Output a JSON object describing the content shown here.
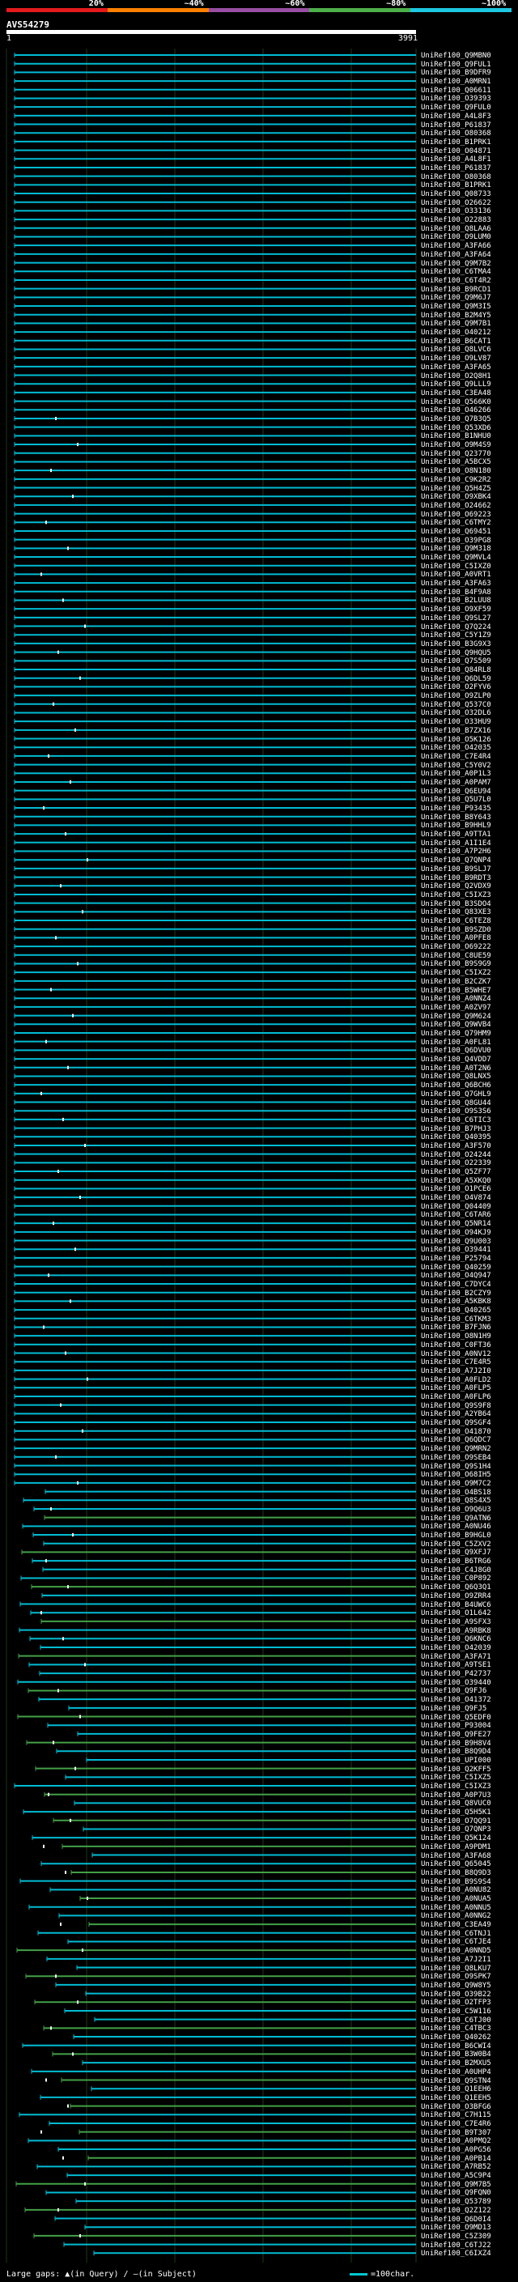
{
  "legend": {
    "percent_labels": [
      "20%",
      "~40%",
      "~60%",
      "~80%",
      "~100%"
    ],
    "colors": [
      "#e41a1c",
      "#ff7f00",
      "#984ea3",
      "#4daf4a",
      "#1ec8e0"
    ]
  },
  "query": {
    "id": "AVS54279",
    "start": "1",
    "end": "3991"
  },
  "colors": {
    "cyan": "#00bcd4",
    "green": "#43a047",
    "dark": "#0d2436",
    "mark": "#ffffff"
  },
  "hits": [
    "UniRef100_Q9MBN0",
    "UniRef100_Q9FUL1",
    "UniRef100_B9DFR9",
    "UniRef100_A0MRN1",
    "UniRef100_Q06611",
    "UniRef100_O39393",
    "UniRef100_Q9FUL0",
    "UniRef100_A4L8F3",
    "UniRef100_P61837",
    "UniRef100_O80368",
    "UniRef100_B1PRK1",
    "UniRef100_O04871",
    "UniRef100_A4L8F1",
    "UniRef100_P61837",
    "UniRef100_O80368",
    "UniRef100_B1PRK1",
    "UniRef100_Q08733",
    "UniRef100_O26622",
    "UniRef100_O33136",
    "UniRef100_O22883",
    "UniRef100_Q8LAA6",
    "UniRef100_O9LUM0",
    "UniRef100_A3FA66",
    "UniRef100_A3FA64",
    "UniRef100_Q9M7B2",
    "UniRef100_C6TMA4",
    "UniRef100_C6T4R2",
    "UniRef100_B9RCD1",
    "UniRef100_Q9M6J7",
    "UniRef100_Q9M3I5",
    "UniRef100_B2M4Y5",
    "UniRef100_Q9M7B1",
    "UniRef100_O40212",
    "UniRef100_B6CAT1",
    "UniRef100_Q8LVC6",
    "UniRef100_O9LV87",
    "UniRef100_A3FA65",
    "UniRef100_O2Q8H1",
    "UniRef100_Q9LLL9",
    "UniRef100_C3EA48",
    "UniRef100_Q566K0",
    "UniRef100_O46266",
    "UniRef100_Q7B3Q5",
    "UniRef100_Q53XD6",
    "UniRef100_B1NHU0",
    "UniRef100_O9M4S9",
    "UniRef100_Q23770",
    "UniRef100_A5BCX5",
    "UniRef100_O8N180",
    "UniRef100_C9K2R2",
    "UniRef100_Q5H4Z5",
    "UniRef100_O9XBK4",
    "UniRef100_O24662",
    "UniRef100_O69223",
    "UniRef100_C6TMY2",
    "UniRef100_Q69451",
    "UniRef100_O39PG8",
    "UniRef100_Q9M318",
    "UniRef100_Q9MVL4",
    "UniRef100_C5IXZ0",
    "UniRef100_A0VRT1",
    "UniRef100_A3FA63",
    "UniRef100_B4F9A8",
    "UniRef100_B2LUU8",
    "UniRef100_O9XF59",
    "UniRef100_Q9SL27",
    "UniRef100_Q7Q224",
    "UniRef100_C5Y1Z9",
    "UniRef100_B3G9X3",
    "UniRef100_Q9HQU5",
    "UniRef100_Q7S509",
    "UniRef100_Q84RL8",
    "UniRef100_Q6DL59",
    "UniRef100_O2FYV6",
    "UniRef100_O9ZLP0",
    "UniRef100_Q537C0",
    "UniRef100_O32DL6",
    "UniRef100_O33HU9",
    "UniRef100_B7ZX16",
    "UniRef100_O5K126",
    "UniRef100_O42035",
    "UniRef100_C7E4R4",
    "UniRef100_C5Y0V2",
    "UniRef100_A0P1L3",
    "UniRef100_A0PAM7",
    "UniRef100_Q6EU94",
    "UniRef100_Q5U7L0",
    "UniRef100_P93435",
    "UniRef100_B8Y643",
    "UniRef100_B9HHL9",
    "UniRef100_A9TTA1",
    "UniRef100_A1I1E4",
    "UniRef100_A7P2H6",
    "UniRef100_Q7QNP4",
    "UniRef100_B9SLJ7",
    "UniRef100_B9RDT3",
    "UniRef100_Q2VDX9",
    "UniRef100_C5IXZ3",
    "UniRef100_B3SDO4",
    "UniRef100_Q83XE3",
    "UniRef100_C6TEZ8",
    "UniRef100_B9SZD0",
    "UniRef100_A0PFE8",
    "UniRef100_O69222",
    "UniRef100_C8UE59",
    "UniRef100_B9S9G9",
    "UniRef100_C5IXZ2",
    "UniRef100_B2CZK7",
    "UniRef100_B5WHE7",
    "UniRef100_A0NNZ4",
    "UniRef100_A0ZV97",
    "UniRef100_Q9M624",
    "UniRef100_Q9WVB4",
    "UniRef100_Q79HM9",
    "UniRef100_A0FL81",
    "UniRef100_Q6DVU0",
    "UniRef100_Q4VDD7",
    "UniRef100_A0T2N6",
    "UniRef100_Q8LNX5",
    "UniRef100_Q6BCH6",
    "UniRef100_Q7GHL9",
    "UniRef100_Q8GU44",
    "UniRef100_O9S3S6",
    "UniRef100_C6TIC3",
    "UniRef100_B7PHJ3",
    "UniRef100_Q40395",
    "UniRef100_A3F570",
    "UniRef100_O24244",
    "UniRef100_O22339",
    "UniRef100_Q5ZF77",
    "UniRef100_A5XKQ0",
    "UniRef100_O1PCE6",
    "UniRef100_O4V874",
    "UniRef100_Q04409",
    "UniRef100_C6TAR6",
    "UniRef100_Q5NR14",
    "UniRef100_O94KJ9",
    "UniRef100_Q9U003",
    "UniRef100_O39441",
    "UniRef100_P25794",
    "UniRef100_Q40259",
    "UniRef100_O4Q947",
    "UniRef100_C7DYC4",
    "UniRef100_B2CZY9",
    "UniRef100_A5KBK8",
    "UniRef100_Q40265",
    "UniRef100_C6TKM3",
    "UniRef100_B7FJN6",
    "UniRef100_O8N1H9",
    "UniRef100_C0FT36",
    "UniRef100_A0NV12",
    "UniRef100_C7E4R5",
    "UniRef100_A7J2I0",
    "UniRef100_A0FLD2",
    "UniRef100_A0FLP5",
    "UniRef100_A0FLP6",
    "UniRef100_Q9S9F8",
    "UniRef100_A2YB64",
    "UniRef100_Q9SGF4",
    "UniRef100_O41870",
    "UniRef100_Q6QDC7",
    "UniRef100_Q9MRN2",
    "UniRef100_O9SEB4",
    "UniRef100_Q9S1H4",
    "UniRef100_O68IH5",
    "UniRef100_O9M7C2",
    "UniRef100_O4BS18",
    "UniRef100_Q8S4X5",
    "UniRef100_O9Q6U3",
    "UniRef100_Q9ATN6",
    "UniRef100_A0NU46",
    "UniRef100_B9HGL0",
    "UniRef100_C5ZXV2",
    "UniRef100_Q9XFJ7",
    "UniRef100_B6TRG6",
    "UniRef100_C4J8G0",
    "UniRef100_C0P892",
    "UniRef100_Q6Q3Q1",
    "UniRef100_O9ZRR4",
    "UniRef100_B4UWC6",
    "UniRef100_O1L642",
    "UniRef100_A9SFX3",
    "UniRef100_A9RBK8",
    "UniRef100_Q6KNC6",
    "UniRef100_O42039",
    "UniRef100_A3FA71",
    "UniRef100_A9TSE1",
    "UniRef100_P42737",
    "UniRef100_O39440",
    "UniRef100_Q9FJ6",
    "UniRef100_O41372",
    "UniRef100_Q9FJ5",
    "UniRef100_Q5EDF0",
    "UniRef100_P93004",
    "UniRef100_Q9FE27",
    "UniRef100_B9H8V4",
    "UniRef100_B8Q9D4",
    "UniRef100_UPI000",
    "UniRef100_Q2KFF5",
    "UniRef100_C5IXZ5",
    "UniRef100_C5IXZ3",
    "UniRef100_A0P7U3",
    "UniRef100_Q8VUC0",
    "UniRef100_Q5H5K1",
    "UniRef100_O7QQ91",
    "UniRef100_Q7QNP3",
    "UniRef100_Q5K124",
    "UniRef100_A9PDM1",
    "UniRef100_A3FA68",
    "UniRef100_Q65045",
    "UniRef100_B8Q9D3",
    "UniRef100_B9S9S4",
    "UniRef100_A0NU82",
    "UniRef100_A0NUA5",
    "UniRef100_A0NNU5",
    "UniRef100_A0NNG2",
    "UniRef100_C3EA49",
    "UniRef100_C6TNJ1",
    "UniRef100_C6TJE4",
    "UniRef100_A0NND5",
    "UniRef100_A7J2I1",
    "UniRef100_Q8LKU7",
    "UniRef100_O9SPK7",
    "UniRef100_Q9W8Y5",
    "UniRef100_O39B22",
    "UniRef100_O2TFP3",
    "UniRef100_C5W116",
    "UniRef100_C6TJ00",
    "UniRef100_C4TBC3",
    "UniRef100_Q40262",
    "UniRef100_B6CWI4",
    "UniRef100_B3W0B4",
    "UniRef100_B2MXU5",
    "UniRef100_A0UHP4",
    "UniRef100_Q9STN4",
    "UniRef100_Q1EEH6",
    "UniRef100_Q1EEH5",
    "UniRef100_O3BFG6",
    "UniRef100_C7H115",
    "UniRef100_C7E4R6",
    "UniRef100_B9T307",
    "UniRef100_A0PMQ2",
    "UniRef100_A0PG56",
    "UniRef100_A0PB14",
    "UniRef100_A7RB52",
    "UniRef100_A5C9P4",
    "UniRef100_Q9M7B5",
    "UniRef100_Q9FQN0",
    "UniRef100_Q53789",
    "UniRef100_Q2Z122",
    "UniRef100_Q6D0I4",
    "UniRef100_O9MD13",
    "UniRef100_C5Z309",
    "UniRef100_C6TJ22",
    "UniRef100_C6IXZ4"
  ],
  "footer": {
    "large_gaps": "Large gaps:",
    "in_query": "(in Query)",
    "sep": "/",
    "in_subject": "(in Subject)",
    "scale": "=100char."
  }
}
